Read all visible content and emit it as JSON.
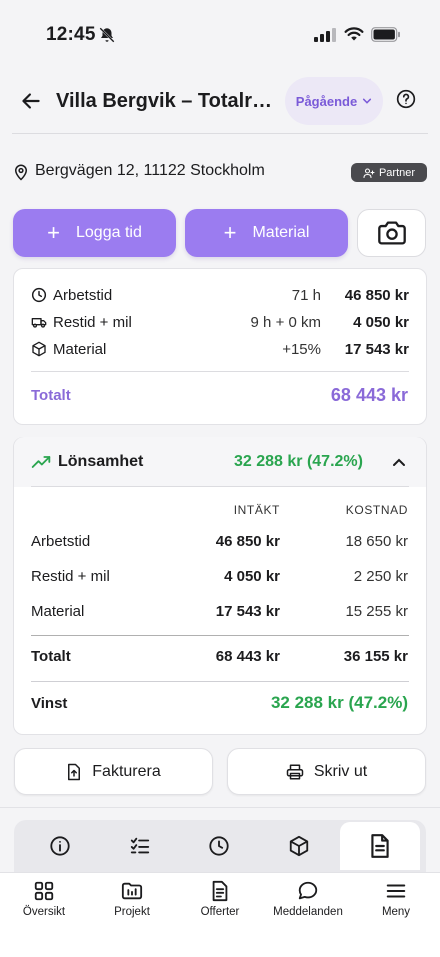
{
  "status_bar": {
    "time": "12:45"
  },
  "header": {
    "title": "Villa Bergvik – Totalr…",
    "status": "Pågående"
  },
  "project": {
    "address": "Bergvägen 12, 11122 Stockholm",
    "badge": "Partner"
  },
  "actions": {
    "log_time": "Logga tid",
    "material": "Material"
  },
  "summary": {
    "rows": [
      {
        "icon": "clock-icon",
        "label": "Arbetstid",
        "detail": "71 h",
        "value": "46 850 kr"
      },
      {
        "icon": "van-icon",
        "label": "Restid + mil",
        "detail": "9 h + 0 km",
        "value": "4 050 kr"
      },
      {
        "icon": "box-icon",
        "label": "Material",
        "detail": "+15%",
        "value": "17 543 kr"
      }
    ],
    "total_label": "Totalt",
    "total_value": "68 443 kr"
  },
  "profitability": {
    "title": "Lönsamhet",
    "header_value": "32 288 kr (47.2%)",
    "col_income": "INTÄKT",
    "col_cost": "KOSTNAD",
    "rows": [
      {
        "label": "Arbetstid",
        "income": "46 850 kr",
        "cost": "18 650 kr"
      },
      {
        "label": "Restid + mil",
        "income": "4 050 kr",
        "cost": "2 250 kr"
      },
      {
        "label": "Material",
        "income": "17 543 kr",
        "cost": "15 255 kr"
      }
    ],
    "total": {
      "label": "Totalt",
      "income": "68 443 kr",
      "cost": "36 155 kr"
    },
    "profit_label": "Vinst",
    "profit_value": "32 288 kr (47.2%)"
  },
  "buttons": {
    "invoice": "Fakturera",
    "print": "Skriv ut"
  },
  "section_tabs": [
    "info-icon",
    "checklist-icon",
    "clock-icon",
    "box-icon",
    "document-icon"
  ],
  "active_section_tab": 4,
  "bottom_nav": [
    {
      "icon": "grid-icon",
      "label": "Översikt"
    },
    {
      "icon": "folder-icon",
      "label": "Projekt"
    },
    {
      "icon": "document-icon",
      "label": "Offerter"
    },
    {
      "icon": "chat-icon",
      "label": "Meddelanden"
    },
    {
      "icon": "menu-icon",
      "label": "Meny"
    }
  ],
  "colors": {
    "accent": "#9b7cf0",
    "accent_text": "#8a6ad8",
    "profit_green": "#2aa54f"
  }
}
